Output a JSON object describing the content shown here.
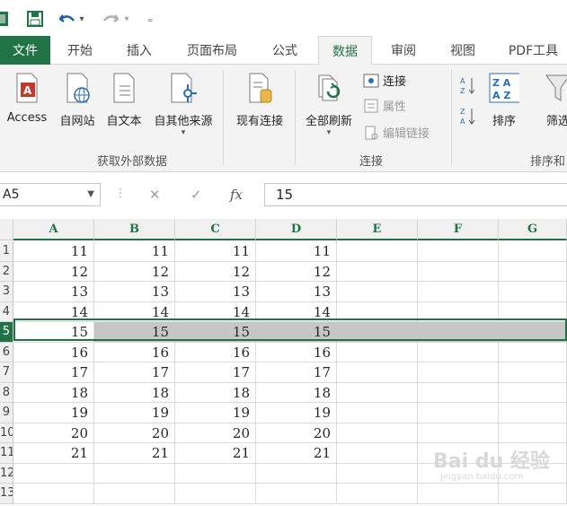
{
  "qat": {
    "undo_dropdown": "▾",
    "redo_dropdown": "▾",
    "customize": "₌"
  },
  "tabs": [
    {
      "label": "文件"
    },
    {
      "label": "开始"
    },
    {
      "label": "插入"
    },
    {
      "label": "页面布局"
    },
    {
      "label": "公式"
    },
    {
      "label": "数据"
    },
    {
      "label": "审阅"
    },
    {
      "label": "视图"
    },
    {
      "label": "PDF工具"
    }
  ],
  "ribbon": {
    "external": {
      "access": "Access",
      "web": "自网站",
      "text": "自文本",
      "other": "自其他来源",
      "group_label": "获取外部数据"
    },
    "existing": "现有连接",
    "refresh_all": "全部刷新",
    "connections": {
      "connections": "连接",
      "properties": "属性",
      "edit_links": "编辑链接",
      "group_label": "连接"
    },
    "sort": {
      "sort_label": "排序",
      "filter_label": "筛选",
      "group_label": "排序和",
      "az": "A Z",
      "za": "Z A"
    }
  },
  "formula_bar": {
    "name_box": "A5",
    "cancel": "✕",
    "enter": "✓",
    "fx": "fx",
    "value": "15"
  },
  "columns": [
    "A",
    "B",
    "C",
    "D",
    "E",
    "F",
    "G"
  ],
  "rows": [
    {
      "num": "1",
      "values": [
        "11",
        "11",
        "11",
        "11"
      ]
    },
    {
      "num": "2",
      "values": [
        "12",
        "12",
        "12",
        "12"
      ]
    },
    {
      "num": "3",
      "values": [
        "13",
        "13",
        "13",
        "13"
      ]
    },
    {
      "num": "4",
      "values": [
        "14",
        "14",
        "14",
        "14"
      ]
    },
    {
      "num": "5",
      "values": [
        "15",
        "15",
        "15",
        "15"
      ]
    },
    {
      "num": "6",
      "values": [
        "16",
        "16",
        "16",
        "16"
      ]
    },
    {
      "num": "7",
      "values": [
        "17",
        "17",
        "17",
        "17"
      ]
    },
    {
      "num": "8",
      "values": [
        "18",
        "18",
        "18",
        "18"
      ]
    },
    {
      "num": "9",
      "values": [
        "19",
        "19",
        "19",
        "19"
      ]
    },
    {
      "num": "10",
      "values": [
        "20",
        "20",
        "20",
        "20"
      ]
    },
    {
      "num": "11",
      "values": [
        "21",
        "21",
        "21",
        "21"
      ]
    },
    {
      "num": "12",
      "values": [
        "",
        "",
        "",
        ""
      ]
    },
    {
      "num": "13",
      "values": [
        "",
        "",
        "",
        ""
      ]
    }
  ],
  "selected_row": "5",
  "watermark": {
    "text": "Bai du 经验",
    "sub": "jingyan.baidu.com"
  },
  "colors": {
    "excel_green": "#217346",
    "selection_gray": "#c6c6c6"
  }
}
